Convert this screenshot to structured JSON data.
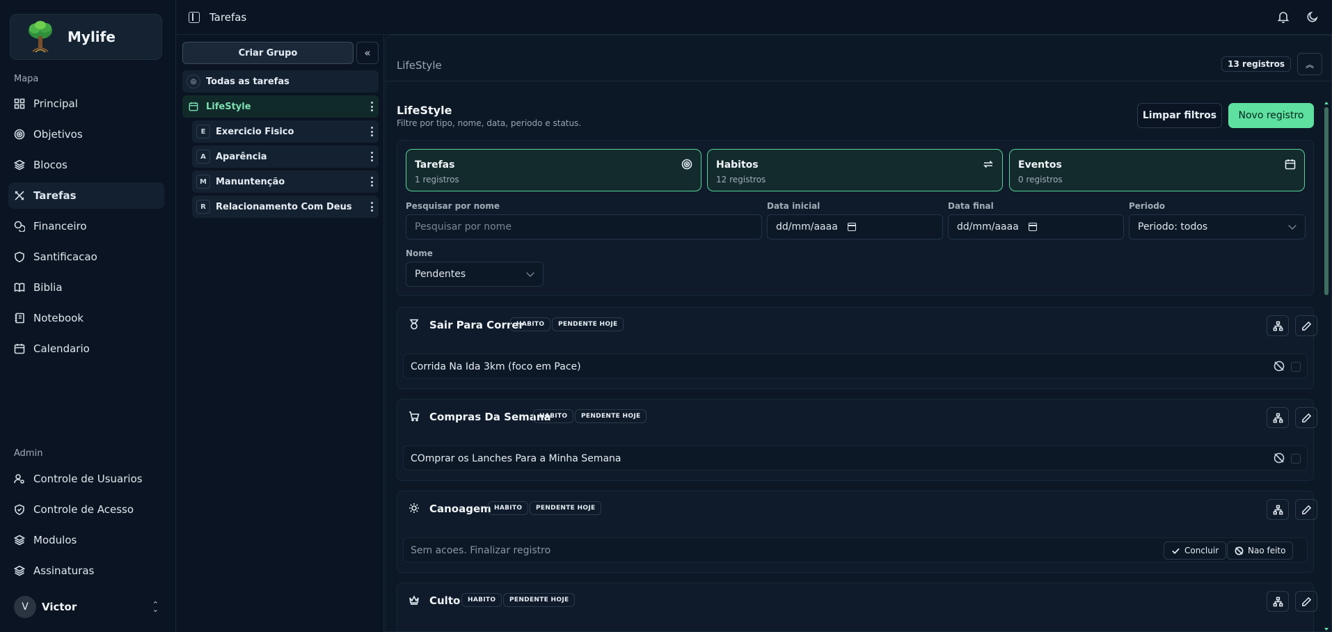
{
  "brand": {
    "name": "Mylife"
  },
  "sidebar": {
    "section_map": "Mapa",
    "items": [
      {
        "label": "Principal",
        "icon": "grid-icon"
      },
      {
        "label": "Objetivos",
        "icon": "target-icon"
      },
      {
        "label": "Blocos",
        "icon": "layers-icon"
      },
      {
        "label": "Tarefas",
        "icon": "tasks-icon",
        "active": true
      },
      {
        "label": "Financeiro",
        "icon": "coins-icon"
      },
      {
        "label": "Santificacao",
        "icon": "shield-icon"
      },
      {
        "label": "Biblia",
        "icon": "book-icon"
      },
      {
        "label": "Notebook",
        "icon": "notebook-icon"
      },
      {
        "label": "Calendario",
        "icon": "calendar-icon"
      }
    ],
    "section_admin": "Admin",
    "admin_items": [
      {
        "label": "Controle de Usuarios",
        "icon": "user-cog-icon"
      },
      {
        "label": "Controle de Acesso",
        "icon": "shield-check-icon"
      },
      {
        "label": "Modulos",
        "icon": "layers-icon"
      },
      {
        "label": "Assinaturas",
        "icon": "layers-icon"
      }
    ],
    "user": {
      "initial": "V",
      "name": "Victor"
    }
  },
  "topbar": {
    "title": "Tarefas"
  },
  "groups": {
    "create_label": "Criar Grupo",
    "all_label": "Todas as tarefas",
    "selected": "LifeStyle",
    "subgroups": [
      {
        "initial": "E",
        "label": "Exercicio Fisico"
      },
      {
        "initial": "A",
        "label": "Aparência"
      },
      {
        "initial": "M",
        "label": "Manuntenção"
      },
      {
        "initial": "R",
        "label": "Relacionamento Com Deus"
      }
    ]
  },
  "main": {
    "header_title": "LifeStyle",
    "count_label": "13 registros",
    "section_title": "LifeStyle",
    "section_subtitle": "Filtre por tipo, nome, data, periodo e status.",
    "clear_label": "Limpar filtros",
    "new_label": "Novo registro",
    "cards": [
      {
        "title": "Tarefas",
        "sub": "1 registros",
        "icon": "target-icon"
      },
      {
        "title": "Habitos",
        "sub": "12 registros",
        "icon": "repeat-icon"
      },
      {
        "title": "Eventos",
        "sub": "0 registros",
        "icon": "calendar-icon"
      }
    ],
    "filters": {
      "search_label": "Pesquisar por nome",
      "search_placeholder": "Pesquisar por nome",
      "start_label": "Data inicial",
      "start_value": "dd/mm/aaaa",
      "end_label": "Data final",
      "end_value": "dd/mm/aaaa",
      "period_label": "Periodo",
      "period_value": "Periodo: todos",
      "name_label": "Nome",
      "name_value": "Pendentes"
    },
    "tasks": [
      {
        "name": "Sair Para Correr",
        "icon": "medal-icon",
        "badge1": "HABITO",
        "badge2": "PENDENTE HOJE",
        "row": "Corrida Na Ida 3km (foco em Pace)"
      },
      {
        "name": "Compras Da Semana",
        "icon": "cart-icon",
        "badge1": "HABITO",
        "badge2": "PENDENTE HOJE",
        "row": "COmprar os Lanches Para a Minha Semana"
      },
      {
        "name": "Canoagem",
        "icon": "sun-icon",
        "badge1": "HABITO",
        "badge2": "PENDENTE HOJE",
        "row": "Sem acoes. Finalizar registro",
        "conclude": "Concluir",
        "notdone": "Nao feito"
      },
      {
        "name": "Culto",
        "icon": "crown-icon",
        "badge1": "HABITO",
        "badge2": "PENDENTE HOJE"
      }
    ]
  }
}
